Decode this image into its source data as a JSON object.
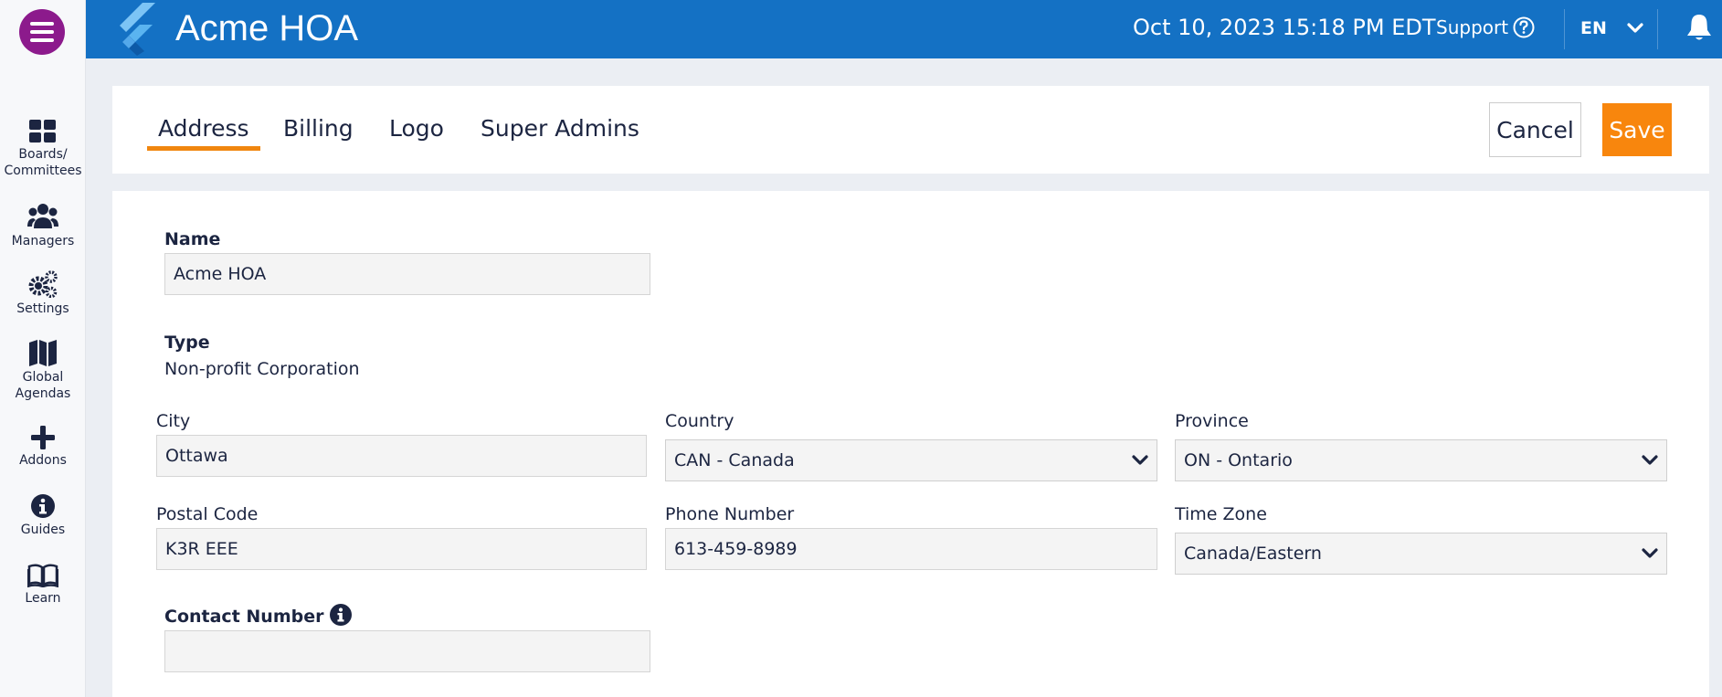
{
  "app": {
    "title": "Acme HOA"
  },
  "header": {
    "datetime": "Oct 10, 2023 15:18 PM  EDT",
    "support_label": "Support",
    "language": "EN"
  },
  "sidebar": {
    "items": [
      {
        "label": "Boards/ Committees",
        "icon": "grid-icon"
      },
      {
        "label": "Managers",
        "icon": "users-icon"
      },
      {
        "label": "Settings",
        "icon": "gears-icon"
      },
      {
        "label": "Global Agendas",
        "icon": "map-icon"
      },
      {
        "label": "Addons",
        "icon": "plus-icon"
      },
      {
        "label": "Guides",
        "icon": "info-icon"
      },
      {
        "label": "Learn",
        "icon": "book-icon"
      }
    ]
  },
  "tabs": [
    {
      "label": "Address",
      "active": true
    },
    {
      "label": "Billing",
      "active": false
    },
    {
      "label": "Logo",
      "active": false
    },
    {
      "label": "Super Admins",
      "active": false
    }
  ],
  "actions": {
    "cancel_label": "Cancel",
    "save_label": "Save"
  },
  "form": {
    "name": {
      "label": "Name",
      "value": "Acme HOA"
    },
    "type": {
      "label": "Type",
      "value": "Non-profit Corporation"
    },
    "city": {
      "label": "City",
      "value": "Ottawa"
    },
    "country": {
      "label": "Country",
      "value": "CAN - Canada"
    },
    "province": {
      "label": "Province",
      "value": "ON - Ontario"
    },
    "postal_code": {
      "label": "Postal Code",
      "value": "K3R EEE"
    },
    "phone_number": {
      "label": "Phone Number",
      "value": "613-459-8989"
    },
    "time_zone": {
      "label": "Time Zone",
      "value": "Canada/Eastern"
    },
    "contact_number": {
      "label": "Contact Number",
      "value": ""
    }
  },
  "colors": {
    "topbar": "#1471c4",
    "menu_button": "#8c1a8c",
    "accent": "#f8860d",
    "text": "#1c2541"
  }
}
